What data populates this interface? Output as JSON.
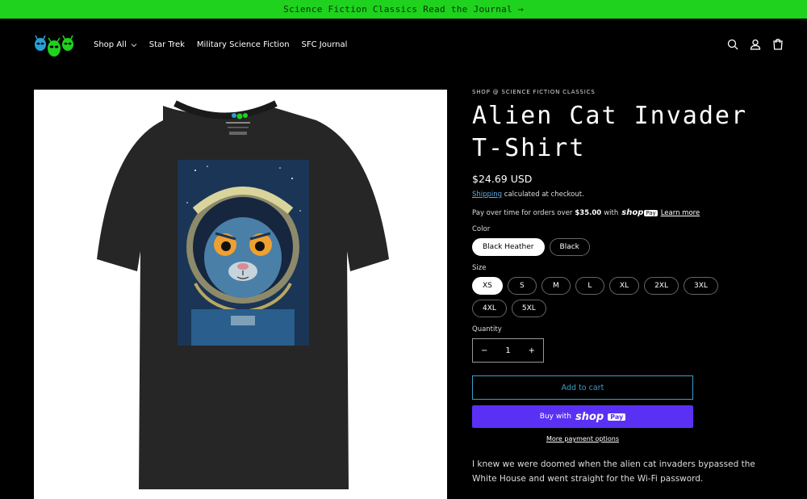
{
  "announcement": {
    "text": "Science Fiction Classics Read the Journal →"
  },
  "nav": {
    "items": [
      {
        "label": "Shop All",
        "has_dropdown": true
      },
      {
        "label": "Star Trek"
      },
      {
        "label": "Military Science Fiction"
      },
      {
        "label": "SFC Journal"
      }
    ]
  },
  "header_icons": [
    "search-icon",
    "account-icon",
    "cart-icon"
  ],
  "product": {
    "vendor": "SHOP @ SCIENCE FICTION CLASSICS",
    "title": "Alien Cat Invader T-Shirt",
    "price": "$24.69 USD",
    "shipping_link": "Shipping",
    "shipping_text": " calculated at checkout.",
    "payover_prefix": "Pay over time for orders over",
    "payover_amount": "$35.00",
    "payover_with": "with",
    "shoppay_brand": "shop",
    "shoppay_pay": "Pay",
    "learn_more": "Learn more",
    "color_label": "Color",
    "colors": [
      {
        "label": "Black Heather",
        "selected": true
      },
      {
        "label": "Black",
        "selected": false
      }
    ],
    "size_label": "Size",
    "sizes": [
      {
        "label": "XS",
        "selected": true
      },
      {
        "label": "S",
        "selected": false
      },
      {
        "label": "M",
        "selected": false
      },
      {
        "label": "L",
        "selected": false
      },
      {
        "label": "XL",
        "selected": false
      },
      {
        "label": "2XL",
        "selected": false
      },
      {
        "label": "3XL",
        "selected": false
      },
      {
        "label": "4XL",
        "selected": false
      },
      {
        "label": "5XL",
        "selected": false
      }
    ],
    "quantity_label": "Quantity",
    "quantity_value": "1",
    "qty_minus": "−",
    "qty_plus": "+",
    "add_to_cart": "Add to cart",
    "buy_with": "Buy with",
    "more_payment": "More payment options",
    "description": "I knew we were doomed when the alien cat invaders bypassed the White House and went straight for the Wi-Fi password."
  },
  "colors": {
    "announcement_bg": "#1ed21e",
    "shoppay_purple": "#5a31f4",
    "add_cart_accent": "#3aa0c8"
  }
}
